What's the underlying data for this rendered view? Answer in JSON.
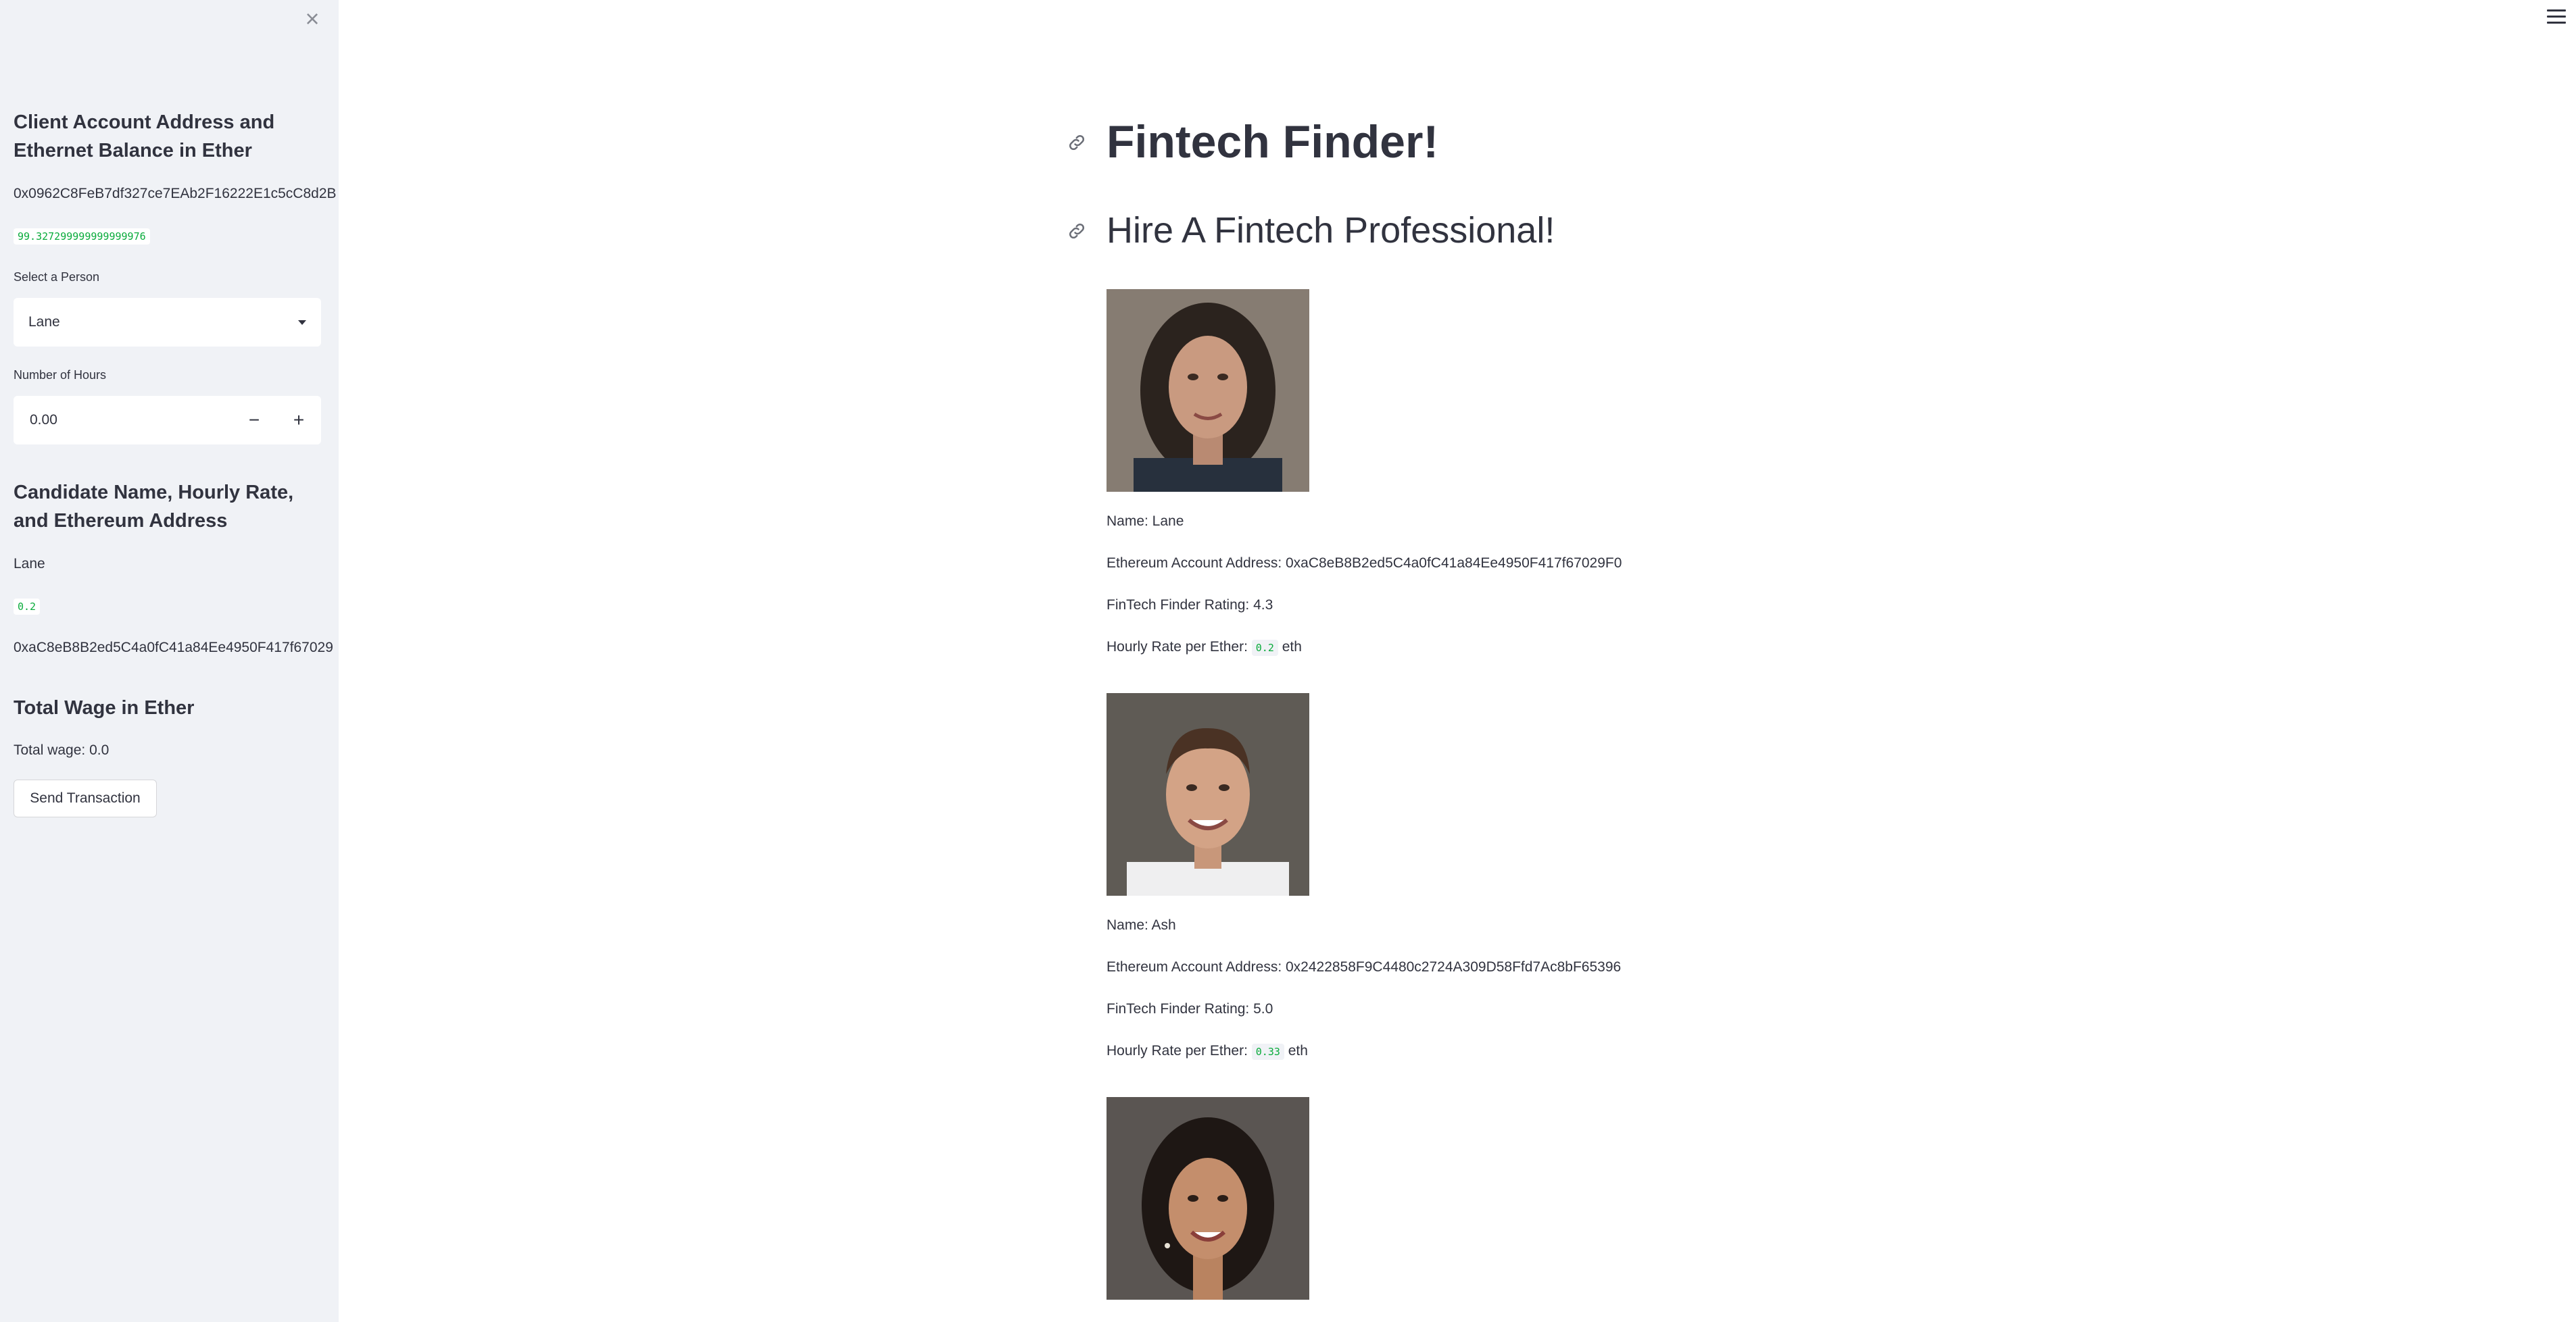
{
  "sidebar": {
    "client_heading": "Client Account Address and Ethernet Balance in Ether",
    "client_address": "0x0962C8FeB7df327ce7EAb2F16222E1c5cC8d2B",
    "client_balance": "99.327299999999999976",
    "select_label": "Select a Person",
    "select_value": "Lane",
    "hours_label": "Number of Hours",
    "hours_value": "0.00",
    "minus": "−",
    "plus": "+",
    "candidate_heading": "Candidate Name, Hourly Rate, and Ethereum Address",
    "candidate_name": "Lane",
    "candidate_rate": "0.2",
    "candidate_address": "0xaC8eB8B2ed5C4a0fC41a84Ee4950F417f67029",
    "wage_heading": "Total Wage in Ether",
    "total_wage": "Total wage: 0.0",
    "send_button": "Send Transaction"
  },
  "main": {
    "title": "Fintech Finder!",
    "subtitle": "Hire A Fintech Professional!",
    "rate_prefix": "Hourly Rate per Ether:",
    "rate_suffix": "eth",
    "candidates": [
      {
        "name": "Name: Lane",
        "address": "Ethereum Account Address: 0xaC8eB8B2ed5C4a0fC41a84Ee4950F417f67029F0",
        "rating": "FinTech Finder Rating: 4.3",
        "rate": "0.2"
      },
      {
        "name": "Name: Ash",
        "address": "Ethereum Account Address: 0x2422858F9C4480c2724A309D58Ffd7Ac8bF65396",
        "rating": "FinTech Finder Rating: 5.0",
        "rate": "0.33"
      }
    ]
  }
}
